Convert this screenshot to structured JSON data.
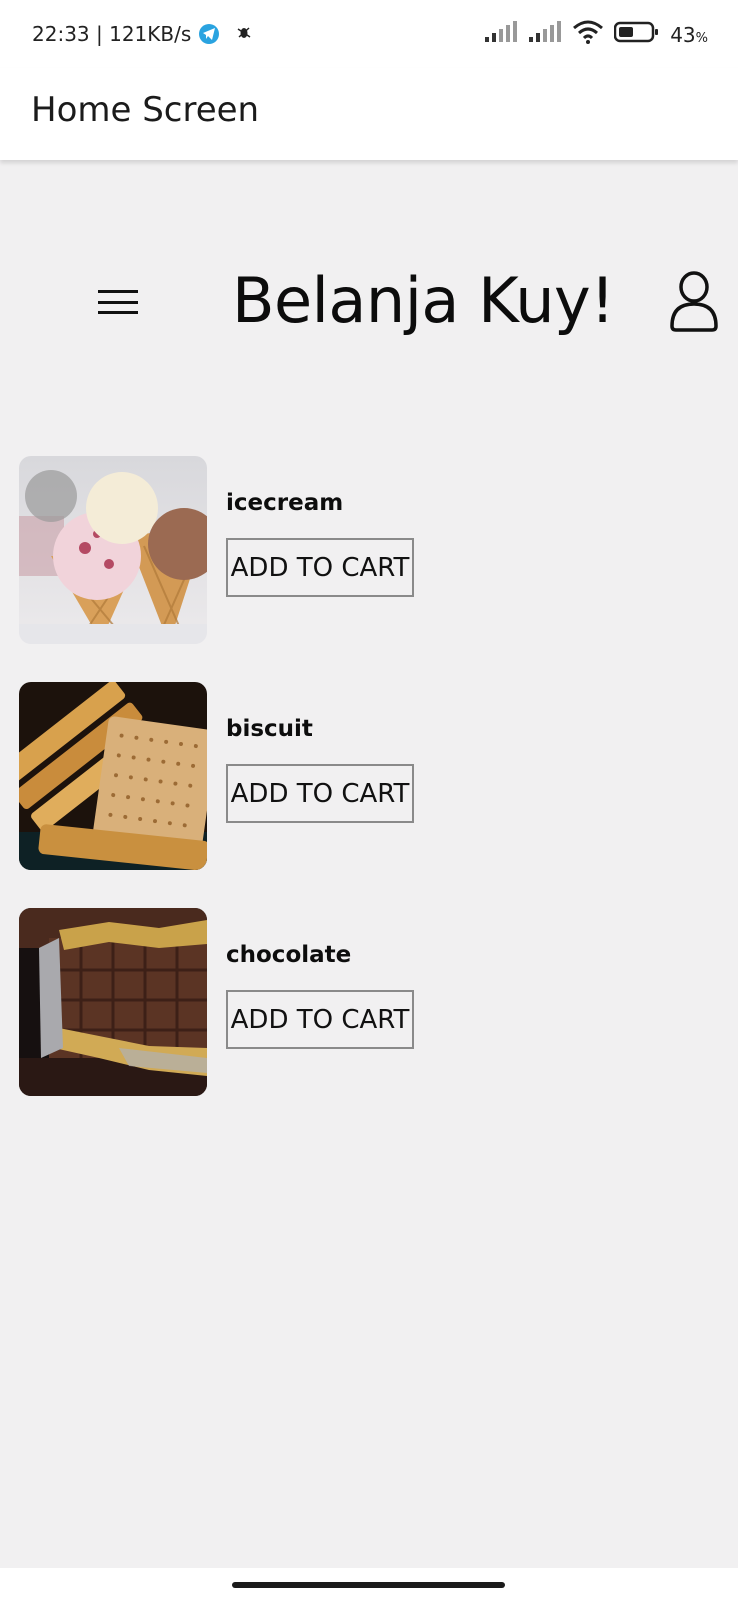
{
  "status_bar": {
    "time": "22:33",
    "speed": "121KB/s",
    "battery_level": "43",
    "battery_unit": "%",
    "icons": [
      "telegram-icon",
      "debug-bug-icon",
      "signal-icon",
      "signal-icon",
      "wifi-icon",
      "battery-icon"
    ]
  },
  "app_bar": {
    "title": "Home Screen"
  },
  "header": {
    "title": "Belanja Kuy!",
    "menu_icon": "hamburger-menu-icon",
    "user_icon": "user-profile-icon"
  },
  "products": [
    {
      "name": "icecream",
      "button": "ADD TO CART"
    },
    {
      "name": "biscuit",
      "button": "ADD TO CART"
    },
    {
      "name": "chocolate",
      "button": "ADD TO CART"
    }
  ],
  "colors": {
    "background": "#f1f0f1",
    "app_bar": "#ffffff",
    "button_border": "#8a8a8a",
    "telegram": "#2aa3e0"
  }
}
